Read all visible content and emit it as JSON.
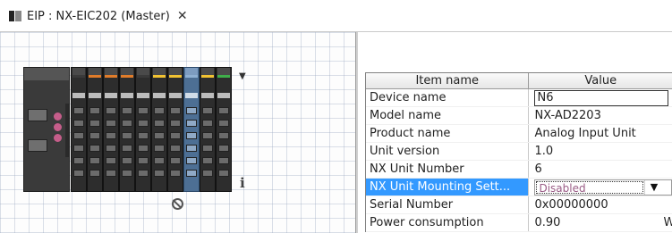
{
  "tab": {
    "title": "EIP : NX-EIC202 (Master)",
    "close_glyph": "✕",
    "icon": "device-config-icon"
  },
  "rack": {
    "selected_slice_index": 7,
    "slices": [
      {
        "band_color": "#3a3a3a"
      },
      {
        "band_color": "#e07c2a"
      },
      {
        "band_color": "#e07c2a"
      },
      {
        "band_color": "#e07c2a"
      },
      {
        "band_color": "#3a3a3a"
      },
      {
        "band_color": "#f1c232"
      },
      {
        "band_color": "#f1c232"
      },
      {
        "band_color": "#8fb0d2"
      },
      {
        "band_color": "#f1c232"
      },
      {
        "band_color": "#3fae4a"
      }
    ],
    "scroll_glyph": "▼",
    "info_glyph": "i"
  },
  "property_grid": {
    "headers": {
      "item": "Item name",
      "value": "Value"
    },
    "rows": [
      {
        "name": "Device name",
        "value": "N6",
        "kind": "edit"
      },
      {
        "name": "Model name",
        "value": "NX-AD2203",
        "kind": "text"
      },
      {
        "name": "Product name",
        "value": "Analog Input Unit",
        "kind": "text"
      },
      {
        "name": "Unit version",
        "value": "1.0",
        "kind": "text"
      },
      {
        "name": "NX Unit Number",
        "value": "6",
        "kind": "text"
      },
      {
        "name": "NX Unit Mounting Sett...",
        "value": "Disabled",
        "kind": "combo",
        "selected": true
      },
      {
        "name": "Serial Number",
        "value": "0x00000000",
        "kind": "text"
      },
      {
        "name": "Power consumption",
        "value": "0.90",
        "kind": "text",
        "suffix": "W"
      }
    ],
    "combo_arrow_glyph": "▼"
  },
  "colors": {
    "selection": "#3399ff",
    "selected_slice": "#4d6f94"
  }
}
